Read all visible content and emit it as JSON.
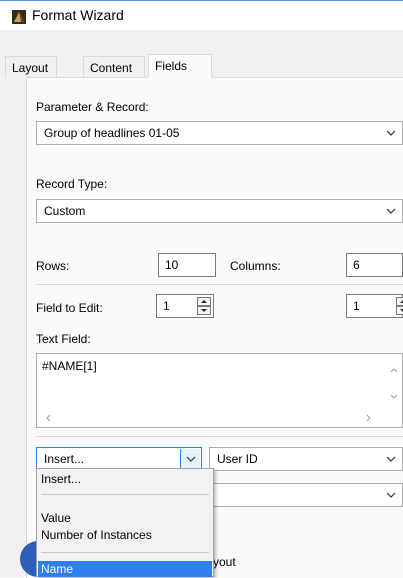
{
  "window": {
    "title": "Format Wizard"
  },
  "tabs": [
    {
      "label": "Layout"
    },
    {
      "label": "Content"
    },
    {
      "label": "Fields"
    }
  ],
  "parameter_record": {
    "label": "Parameter & Record:",
    "value": "Group of headlines 01-05"
  },
  "record_type": {
    "label": "Record Type:",
    "value": "Custom"
  },
  "grid": {
    "rows_label": "Rows:",
    "rows_value": "10",
    "columns_label": "Columns:",
    "columns_value": "6"
  },
  "field_to_edit": {
    "label": "Field to Edit:",
    "row_value": "1",
    "col_value": "1"
  },
  "text_field": {
    "label": "Text Field:",
    "value": "#NAME[1]"
  },
  "insert_select": {
    "value": "Insert..."
  },
  "source_select": {
    "value": "User ID"
  },
  "insert_menu": {
    "items": [
      "Insert...",
      "Value",
      "Number of Instances",
      "Name"
    ],
    "selected": "Name"
  },
  "layout_button": {
    "label_fragment": "yout"
  },
  "colors": {
    "accent": "#2f80ed",
    "panel": "#fafafa",
    "dialog": "#f0f0f0"
  }
}
